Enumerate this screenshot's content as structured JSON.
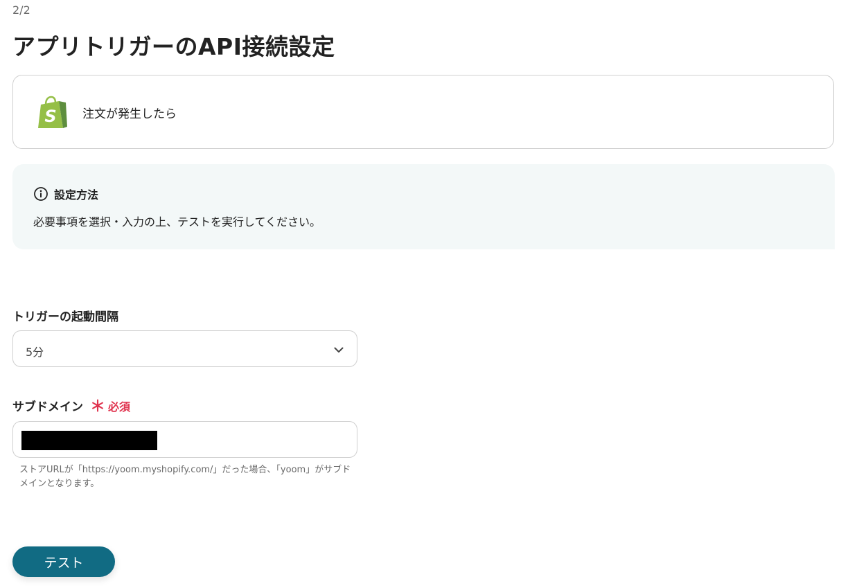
{
  "header": {
    "step": "2/2",
    "title": "アプリトリガーのAPI接続設定"
  },
  "trigger": {
    "app_icon": "shopify-icon",
    "label": "注文が発生したら"
  },
  "info": {
    "icon": "info-icon",
    "heading": "設定方法",
    "description": "必要事項を選択・入力の上、テストを実行してください。"
  },
  "interval": {
    "label": "トリガーの起動間隔",
    "selected": "5分",
    "icon": "chevron-down-icon"
  },
  "subdomain": {
    "label": "サブドメイン",
    "required_mark": "＊",
    "required_text": "必須",
    "value_redacted": true,
    "hint": "ストアURLが「https://yoom.myshopify.com/」だった場合、「yoom」がサブドメインとなります。"
  },
  "actions": {
    "test_label": "テスト"
  },
  "colors": {
    "accent": "#116b83",
    "required": "#e0344f",
    "info_bg": "#f3f8f8",
    "shopify_green": "#95bf47"
  }
}
